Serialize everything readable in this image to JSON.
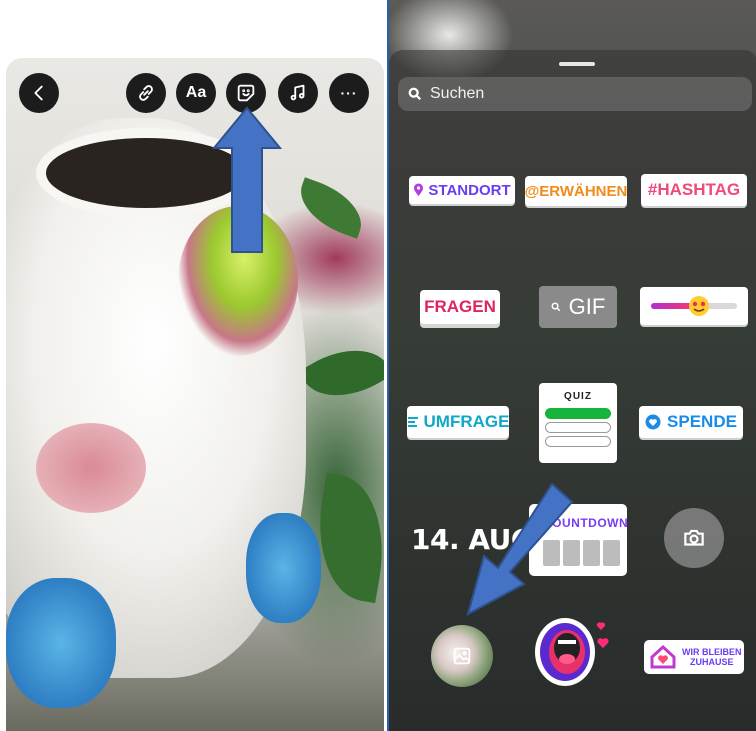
{
  "editor": {
    "toolbar": {
      "back_icon": "chevron-left-icon",
      "link_icon": "link-icon",
      "text_label": "Aa",
      "sticker_icon": "sticker-icon",
      "music_icon": "music-note-icon",
      "more_label": "···"
    },
    "photo_subject": "unicorn-planter-photo"
  },
  "sticker_tray": {
    "search_placeholder": "Suchen",
    "stickers": {
      "standort": "STANDORT",
      "erwaehnen": "@ERWÄHNEN",
      "hashtag": "#HASHTAG",
      "fragen": "FRAGEN",
      "gif": "GIF",
      "umfrage": "UMFRAGE",
      "quiz": "QUIZ",
      "spende": "SPENDE",
      "date": "14. AUG",
      "countdown": "COUNTDOWN",
      "wir_bleiben_line1": "WIR BLEIBEN",
      "wir_bleiben_line2": "ZUHAUSE"
    },
    "emoji_slider_value": 0.55
  },
  "annotations": {
    "arrow_color": "#4472c4"
  }
}
